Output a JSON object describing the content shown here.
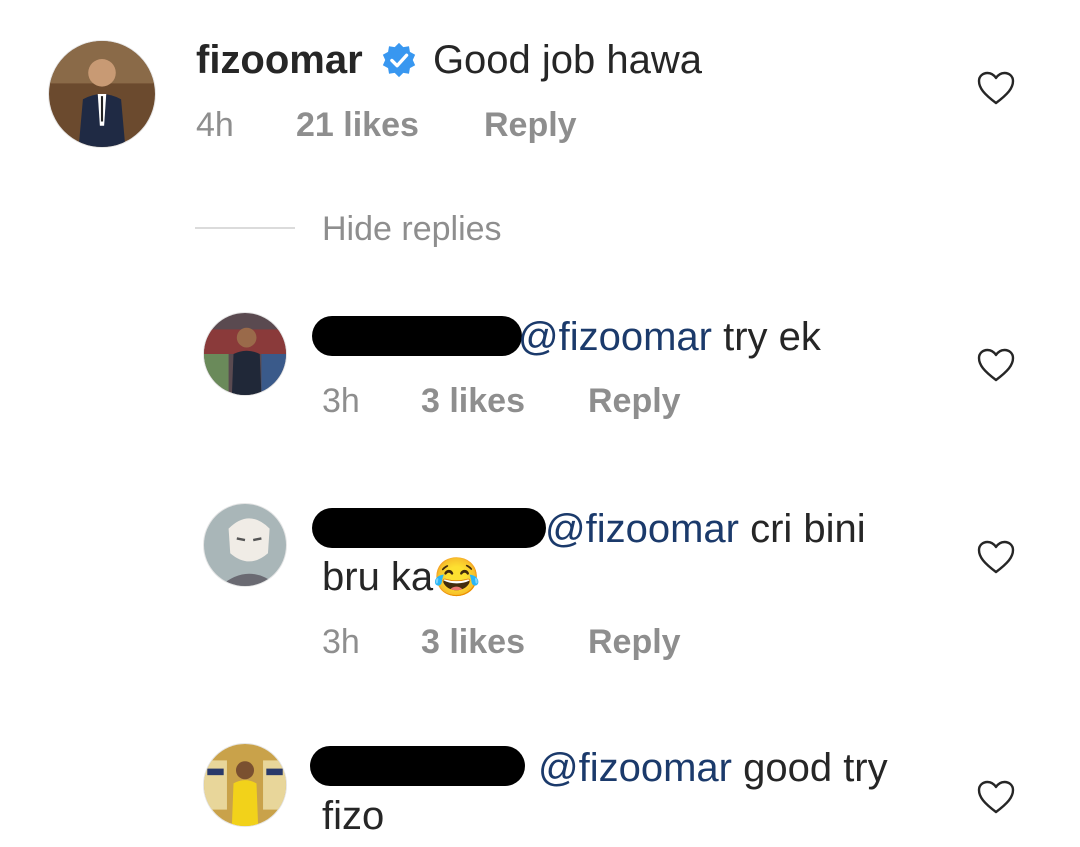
{
  "comment": {
    "username": "fizoomar",
    "text": "Good job hawa",
    "time": "4h",
    "likes": "21 likes",
    "reply": "Reply",
    "verified_color": "#3897f0"
  },
  "hide_replies": "Hide replies",
  "replies": [
    {
      "mention": "@fizoomar",
      "text": " try ek",
      "time": "3h",
      "likes": "3 likes",
      "reply": "Reply"
    },
    {
      "mention": "@fizoomar",
      "text": " cri bini",
      "text2": "bru ka",
      "emoji": "😂",
      "time": "3h",
      "likes": "3 likes",
      "reply": "Reply"
    },
    {
      "mention": "@fizoomar",
      "text": " good try",
      "text2": "fizo"
    }
  ],
  "colors": {
    "text": "#262626",
    "meta": "#8e8e8e",
    "mention": "#1b3a6b"
  }
}
